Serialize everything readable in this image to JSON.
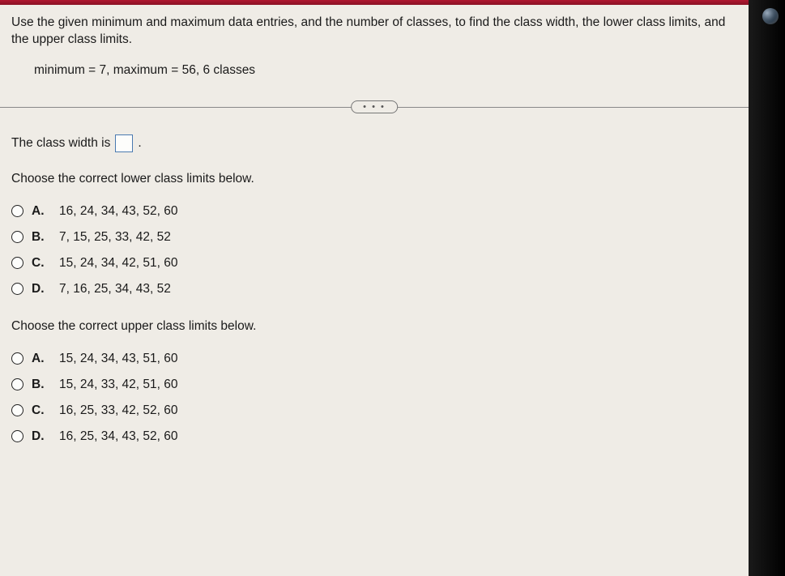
{
  "instruction": "Use the given minimum and maximum data entries, and the number of classes, to find the class width, the lower class limits, and the upper class limits.",
  "params": "minimum = 7,  maximum = 56, 6 classes",
  "ellipsis_label": "• • •",
  "class_width_pre": "The class width is",
  "class_width_post": ".",
  "lower_prompt": "Choose the correct lower class limits below.",
  "lower_options": [
    {
      "letter": "A.",
      "text": "16, 24, 34, 43, 52, 60"
    },
    {
      "letter": "B.",
      "text": "7, 15, 25, 33, 42, 52"
    },
    {
      "letter": "C.",
      "text": "15, 24, 34, 42, 51, 60"
    },
    {
      "letter": "D.",
      "text": "7, 16, 25, 34, 43, 52"
    }
  ],
  "upper_prompt": "Choose the correct upper class limits below.",
  "upper_options": [
    {
      "letter": "A.",
      "text": "15, 24, 34, 43, 51, 60"
    },
    {
      "letter": "B.",
      "text": "15, 24, 33, 42, 51, 60"
    },
    {
      "letter": "C.",
      "text": "16, 25, 33, 42, 52, 60"
    },
    {
      "letter": "D.",
      "text": "16, 25, 34, 43, 52, 60"
    }
  ]
}
